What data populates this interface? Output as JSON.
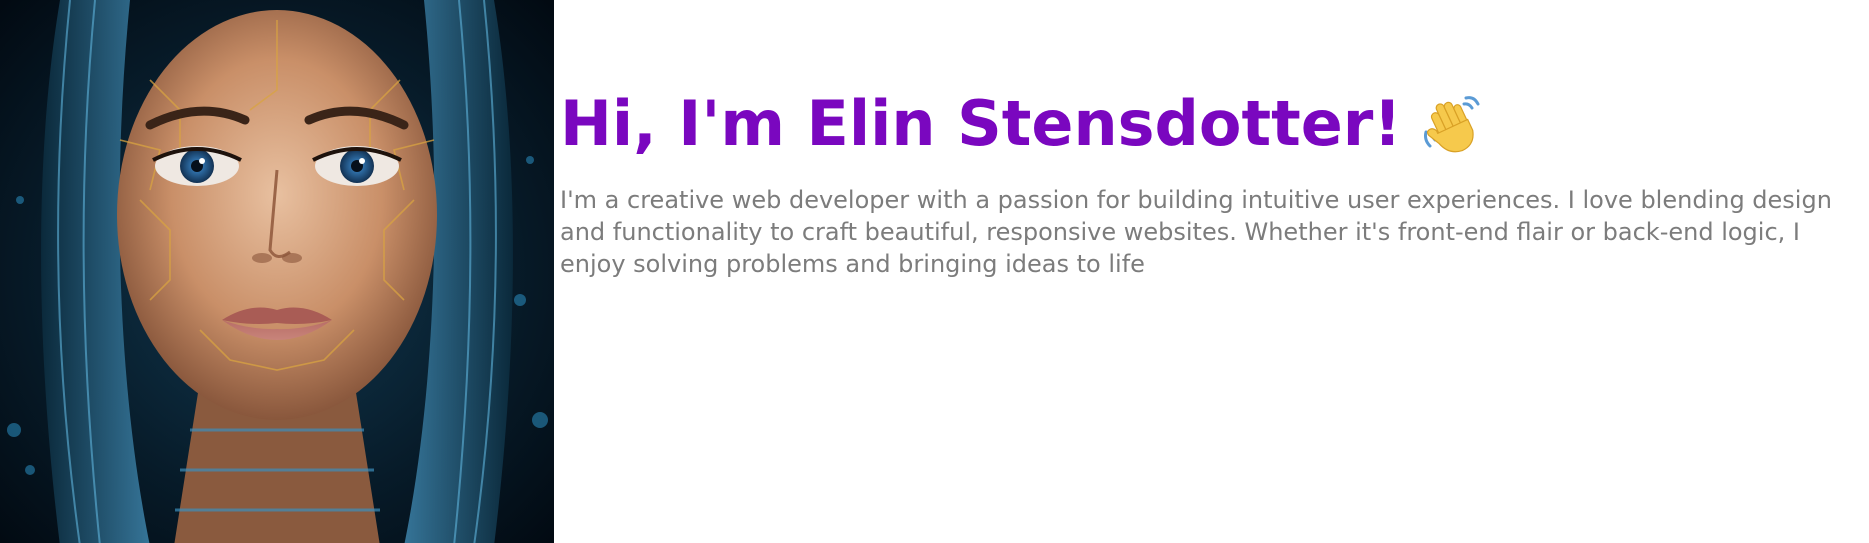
{
  "hero": {
    "heading": "Hi, I'm Elin Stensdotter!",
    "wave_icon": "waving-hand-icon",
    "intro": "I'm a creative web developer with a passion for building intuitive user experiences. I love blending design and functionality to craft beautiful, responsive websites. Whether it's front-end flair or back-end logic, I enjoy solving problems and bringing ideas to life"
  },
  "colors": {
    "heading": "#7a07bf",
    "body_text": "#7c7c7c",
    "background": "#ffffff"
  }
}
